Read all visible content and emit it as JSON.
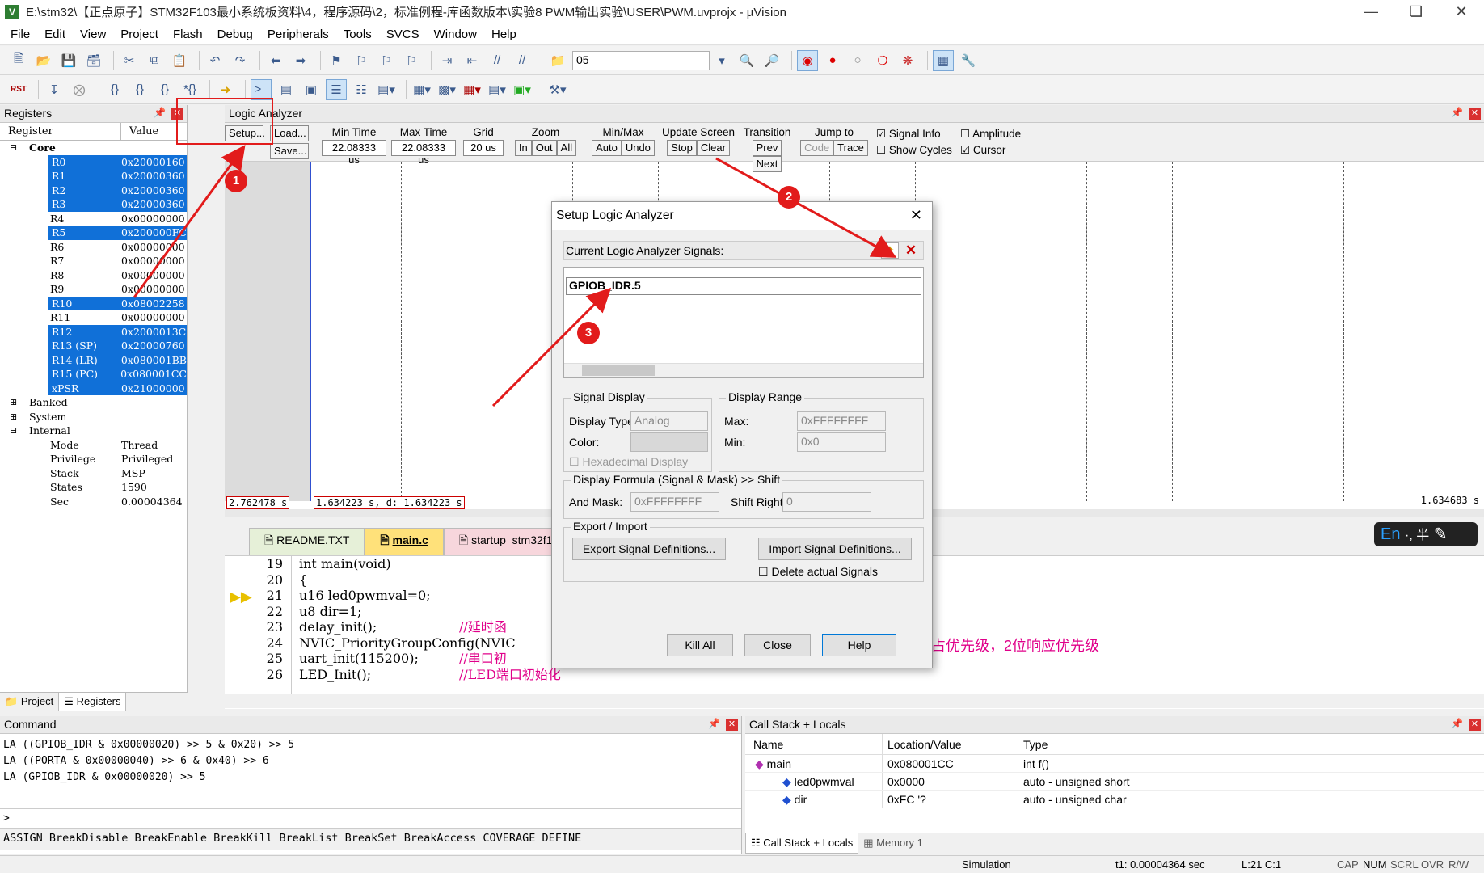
{
  "window": {
    "title": "E:\\stm32\\【正点原子】STM32F103最小系统板资料\\4，程序源码\\2，标准例程-库函数版本\\实验8 PWM输出实验\\USER\\PWM.uvprojx - µVision"
  },
  "menu": [
    "File",
    "Edit",
    "View",
    "Project",
    "Flash",
    "Debug",
    "Peripherals",
    "Tools",
    "SVCS",
    "Window",
    "Help"
  ],
  "toolbar": {
    "combo_value": "05"
  },
  "registers": {
    "title": "Registers",
    "col_register": "Register",
    "col_value": "Value",
    "core_label": "Core",
    "core": [
      {
        "n": "R0",
        "v": "0x20000160",
        "sel": true
      },
      {
        "n": "R1",
        "v": "0x20000360",
        "sel": true
      },
      {
        "n": "R2",
        "v": "0x20000360",
        "sel": true
      },
      {
        "n": "R3",
        "v": "0x20000360",
        "sel": true
      },
      {
        "n": "R4",
        "v": "0x00000000",
        "sel": false
      },
      {
        "n": "R5",
        "v": "0x200000FC",
        "sel": true
      },
      {
        "n": "R6",
        "v": "0x00000000",
        "sel": false
      },
      {
        "n": "R7",
        "v": "0x00000000",
        "sel": false
      },
      {
        "n": "R8",
        "v": "0x00000000",
        "sel": false
      },
      {
        "n": "R9",
        "v": "0x00000000",
        "sel": false
      },
      {
        "n": "R10",
        "v": "0x08002258",
        "sel": true
      },
      {
        "n": "R11",
        "v": "0x00000000",
        "sel": false
      },
      {
        "n": "R12",
        "v": "0x2000013C",
        "sel": true
      },
      {
        "n": "R13 (SP)",
        "v": "0x20000760",
        "sel": true
      },
      {
        "n": "R14 (LR)",
        "v": "0x080001BB",
        "sel": true
      },
      {
        "n": "R15 (PC)",
        "v": "0x080001CC",
        "sel": true
      },
      {
        "n": "xPSR",
        "v": "0x21000000",
        "sel": true
      }
    ],
    "groups": [
      "Banked",
      "System",
      "Internal"
    ],
    "internal": [
      {
        "n": "Mode",
        "v": "Thread"
      },
      {
        "n": "Privilege",
        "v": "Privileged"
      },
      {
        "n": "Stack",
        "v": "MSP"
      },
      {
        "n": "States",
        "v": "1590"
      },
      {
        "n": "Sec",
        "v": "0.00004364"
      }
    ],
    "tabs": [
      "Project",
      "Registers"
    ]
  },
  "logic": {
    "title": "Logic Analyzer",
    "setup": "Setup...",
    "load": "Load...",
    "save": "Save...",
    "min_time_label": "Min Time",
    "min_time": "22.08333 us",
    "max_time_label": "Max Time",
    "max_time": "22.08333 us",
    "grid_label": "Grid",
    "grid": "20 us",
    "zoom_label": "Zoom",
    "zoom_in": "In",
    "zoom_out": "Out",
    "zoom_all": "All",
    "minmax_label": "Min/Max",
    "auto": "Auto",
    "undo": "Undo",
    "update_label": "Update Screen",
    "stop": "Stop",
    "clear": "Clear",
    "transition_label": "Transition",
    "prev": "Prev",
    "next": "Next",
    "jump_label": "Jump to",
    "code": "Code",
    "trace": "Trace",
    "signal_info": "Signal Info",
    "show_cycles": "Show Cycles",
    "amplitude": "Amplitude",
    "cursor": "Cursor",
    "status_left": "2.762478 s",
    "status_mid": "1.634223 s,  d: 1.634223 s",
    "status_right": "1.634683 s"
  },
  "editor": {
    "tabs": [
      "README.TXT",
      "main.c",
      "startup_stm32f10"
    ],
    "lines": [
      {
        "n": "19",
        "code": "int main(void)",
        "comment": ""
      },
      {
        "n": "20",
        "code": "{",
        "comment": ""
      },
      {
        "n": "21",
        "code": "  u16 led0pwmval=0;",
        "comment": ""
      },
      {
        "n": "22",
        "code": "  u8 dir=1;",
        "comment": ""
      },
      {
        "n": "23",
        "code": "  delay_init();",
        "comment": "//延时函"
      },
      {
        "n": "24",
        "code": "  NVIC_PriorityGroupConfig(NVIC",
        "comment": ""
      },
      {
        "n": "25",
        "code": "  uart_init(115200);",
        "comment": "//串口初"
      },
      {
        "n": "26",
        "code": "  LED_Init();",
        "comment": "//LED端口初始化"
      }
    ],
    "right_comment": "占优先级，2位响应优先级"
  },
  "dialog": {
    "title": "Setup Logic Analyzer",
    "current_label": "Current Logic Analyzer Signals:",
    "signal": "GPIOB_IDR.5",
    "signal_display": "Signal Display",
    "display_type_label": "Display Type:",
    "display_type": "Analog",
    "color_label": "Color:",
    "hex_display": "Hexadecimal Display",
    "display_range": "Display Range",
    "max_label": "Max:",
    "max": "0xFFFFFFFF",
    "min_label": "Min:",
    "min": "0x0",
    "formula": "Display Formula (Signal & Mask) >> Shift",
    "and_mask_label": "And Mask:",
    "and_mask": "0xFFFFFFFF",
    "shift_label": "Shift Right:",
    "shift": "0",
    "export_import": "Export / Import",
    "export_btn": "Export Signal Definitions...",
    "import_btn": "Import Signal Definitions...",
    "delete_actual": "Delete actual Signals",
    "kill_all": "Kill All",
    "close": "Close",
    "help": "Help"
  },
  "command": {
    "title": "Command",
    "lines": [
      "LA ((GPIOB_IDR & 0x00000020) >> 5 & 0x20) >> 5",
      "LA ((PORTA & 0x00000040) >> 6 & 0x40) >> 6",
      "LA (GPIOB_IDR & 0x00000020) >> 5"
    ],
    "prompt": ">",
    "hints": "ASSIGN BreakDisable BreakEnable BreakKill BreakList BreakSet BreakAccess COVERAGE DEFINE"
  },
  "callstack": {
    "title": "Call Stack + Locals",
    "cols": [
      "Name",
      "Location/Value",
      "Type"
    ],
    "rows": [
      {
        "name": "main",
        "value": "0x080001CC",
        "type": "int f()"
      },
      {
        "name": "led0pwmval",
        "value": "0x0000",
        "type": "auto - unsigned short"
      },
      {
        "name": "dir",
        "value": "0xFC '?",
        "type": "auto - unsigned char"
      }
    ],
    "tabs": [
      "Call Stack + Locals",
      "Memory 1"
    ]
  },
  "status": {
    "mode": "Simulation",
    "t1": "t1: 0.00004364 sec",
    "pos": "L:21 C:1",
    "caps": "CAP",
    "num": "NUM",
    "scrl": "SCRL",
    "ovr": "OVR",
    "rw": "R/W"
  },
  "ime": {
    "lang": "En",
    "extra": "·, 半"
  },
  "annotations": [
    "1",
    "2",
    "3"
  ],
  "colors": {
    "selection": "#1070d8",
    "annotation": "#e21b1b",
    "comment": "#e0008a"
  }
}
